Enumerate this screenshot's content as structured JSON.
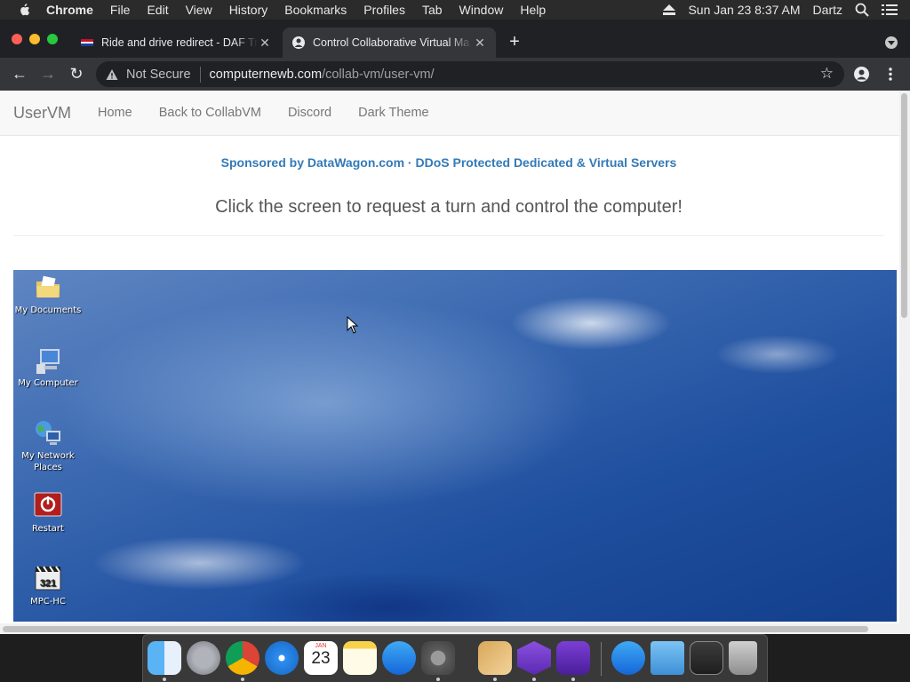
{
  "menubar": {
    "app_name": "Chrome",
    "items": [
      "File",
      "Edit",
      "View",
      "History",
      "Bookmarks",
      "Profiles",
      "Tab",
      "Window",
      "Help"
    ],
    "datetime": "Sun Jan 23  8:37 AM",
    "user": "Dartz"
  },
  "tabs": [
    {
      "title": "Ride and drive redirect - DAF Tr",
      "active": false
    },
    {
      "title": "Control Collaborative Virtual Ma",
      "active": true
    }
  ],
  "toolbar": {
    "security_label": "Not Secure",
    "url_host": "computernewb.com",
    "url_path": "/collab-vm/user-vm/"
  },
  "navbar": {
    "brand": "UserVM",
    "links": [
      "Home",
      "Back to CollabVM",
      "Discord",
      "Dark Theme"
    ]
  },
  "page": {
    "sponsor": "Sponsored by DataWagon.com · DDoS Protected Dedicated & Virtual Servers",
    "instructions": "Click the screen to request a turn and control the computer!"
  },
  "vm_desktop": {
    "icons": [
      {
        "label": "My Documents",
        "icon": "folder-documents-icon"
      },
      {
        "label": "My Computer",
        "icon": "computer-icon"
      },
      {
        "label": "My Network Places",
        "icon": "network-icon"
      },
      {
        "label": "Restart",
        "icon": "restart-icon"
      },
      {
        "label": "MPC-HC",
        "icon": "mpc-hc-icon"
      }
    ]
  },
  "dock": {
    "apps": [
      "finder-icon",
      "launchpad-icon",
      "chrome-icon",
      "safari-icon",
      "calendar-icon",
      "notes-icon",
      "app-store-icon",
      "system-preferences-icon",
      "installer-icon",
      "app-purple-1-icon",
      "app-purple-2-icon",
      "app-store-2-icon",
      "folder-icon",
      "screenshot-icon",
      "trash-icon"
    ],
    "calendar_month": "JAN",
    "calendar_day": "23"
  },
  "colors": {
    "sponsor_link": "#337ab7",
    "navbar_bg": "#f8f8f8",
    "chrome_dark": "#202124"
  }
}
